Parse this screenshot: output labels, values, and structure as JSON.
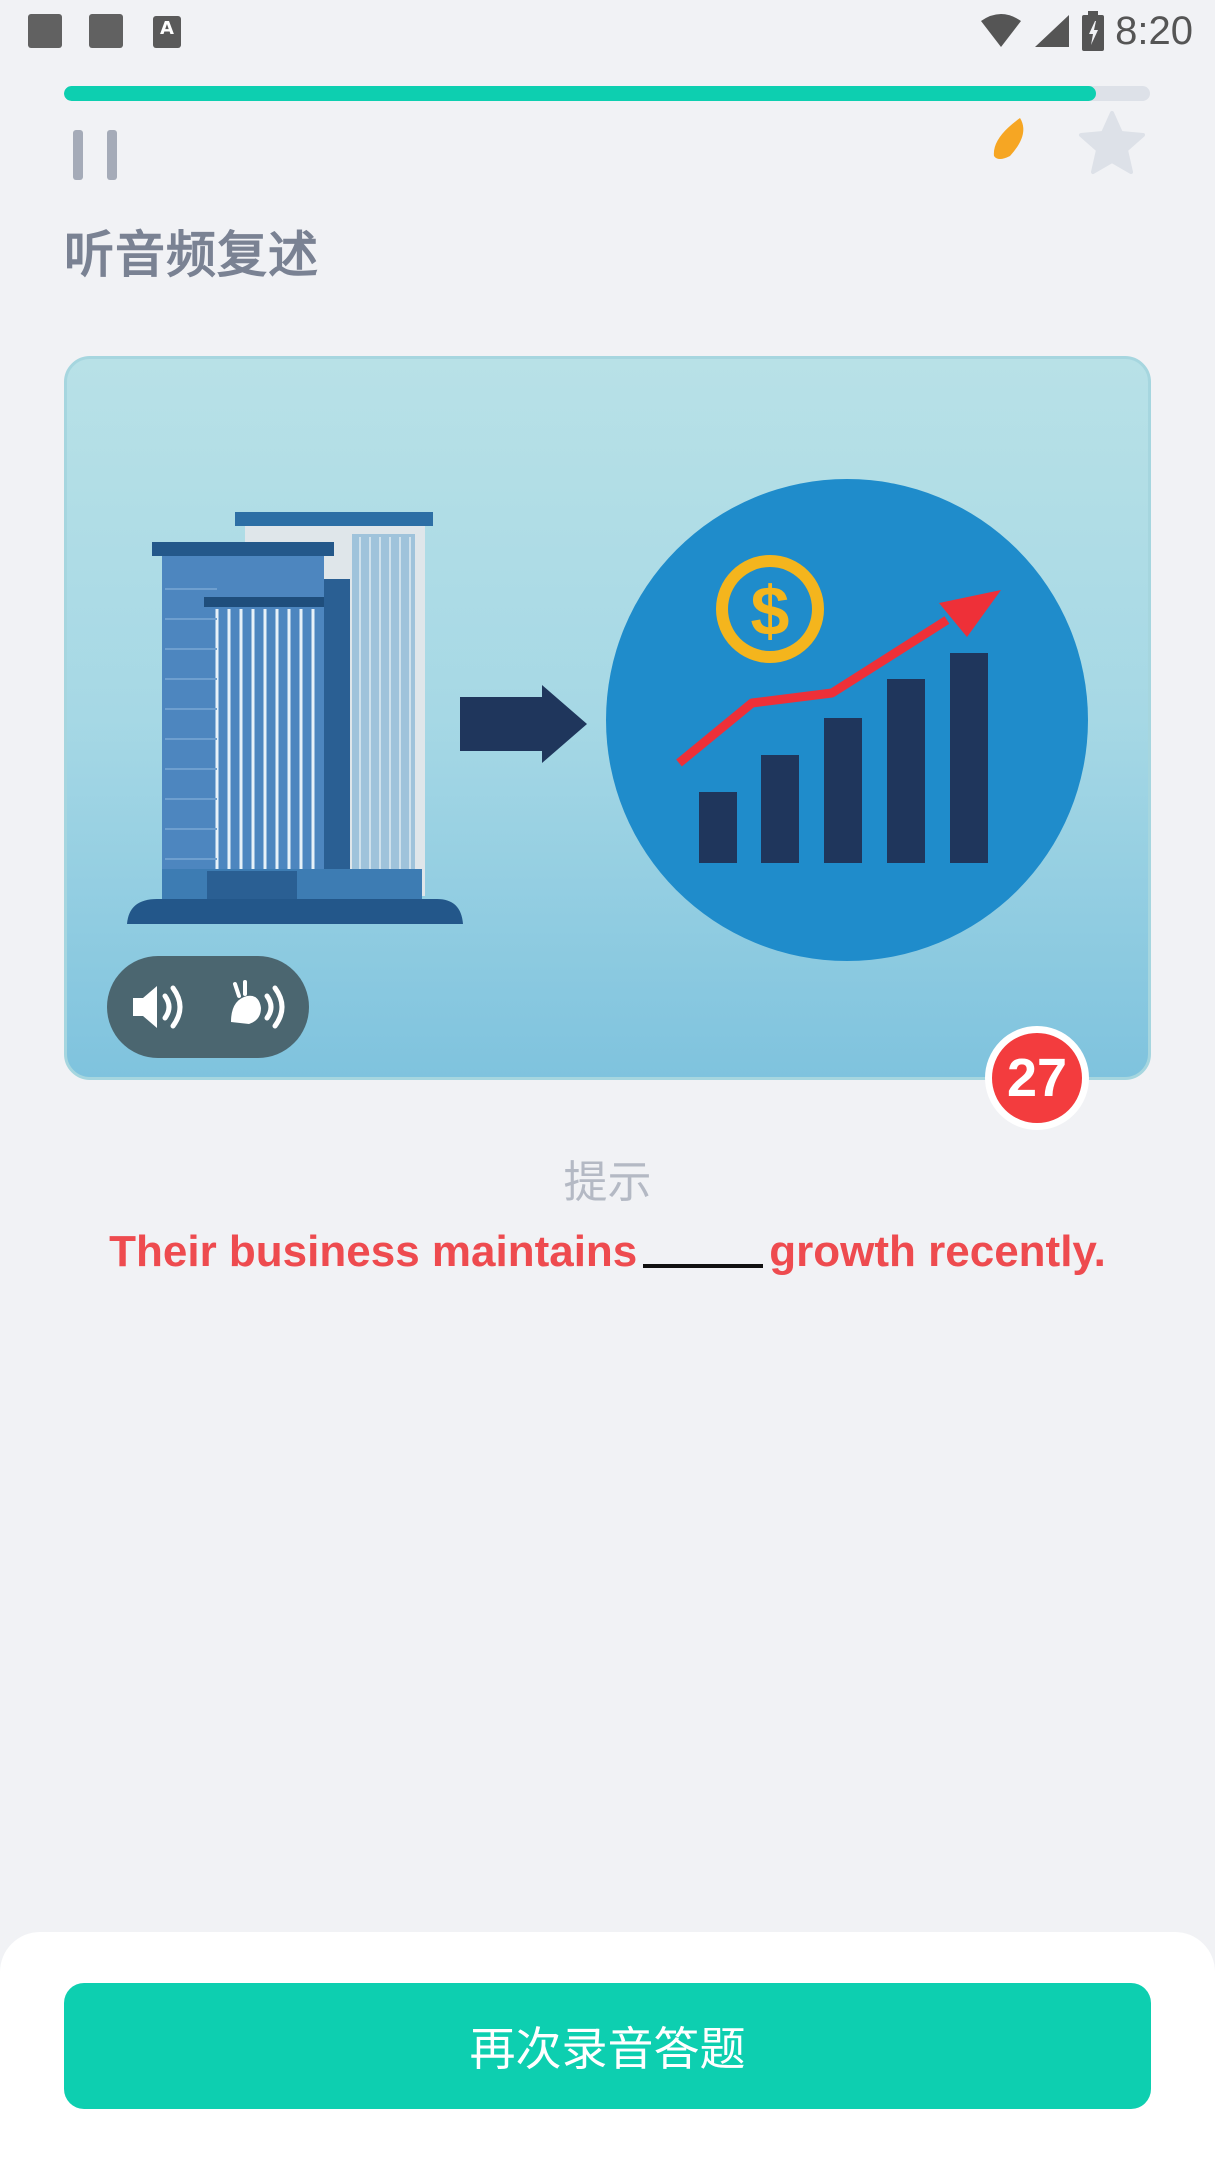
{
  "status_bar": {
    "time": "8:20",
    "a_badge": "A"
  },
  "progress": {
    "fraction": 0.95
  },
  "header": {
    "title": "听音频复述"
  },
  "card": {
    "countdown": "27"
  },
  "hint": {
    "label": "提示",
    "sentence_before": "Their business maintains",
    "sentence_after": "growth recently."
  },
  "footer": {
    "record_button_label": "再次录音答题"
  },
  "colors": {
    "accent": "#0dcfb0",
    "hint_text": "#ee4b4f",
    "badge": "#f33c3e"
  }
}
